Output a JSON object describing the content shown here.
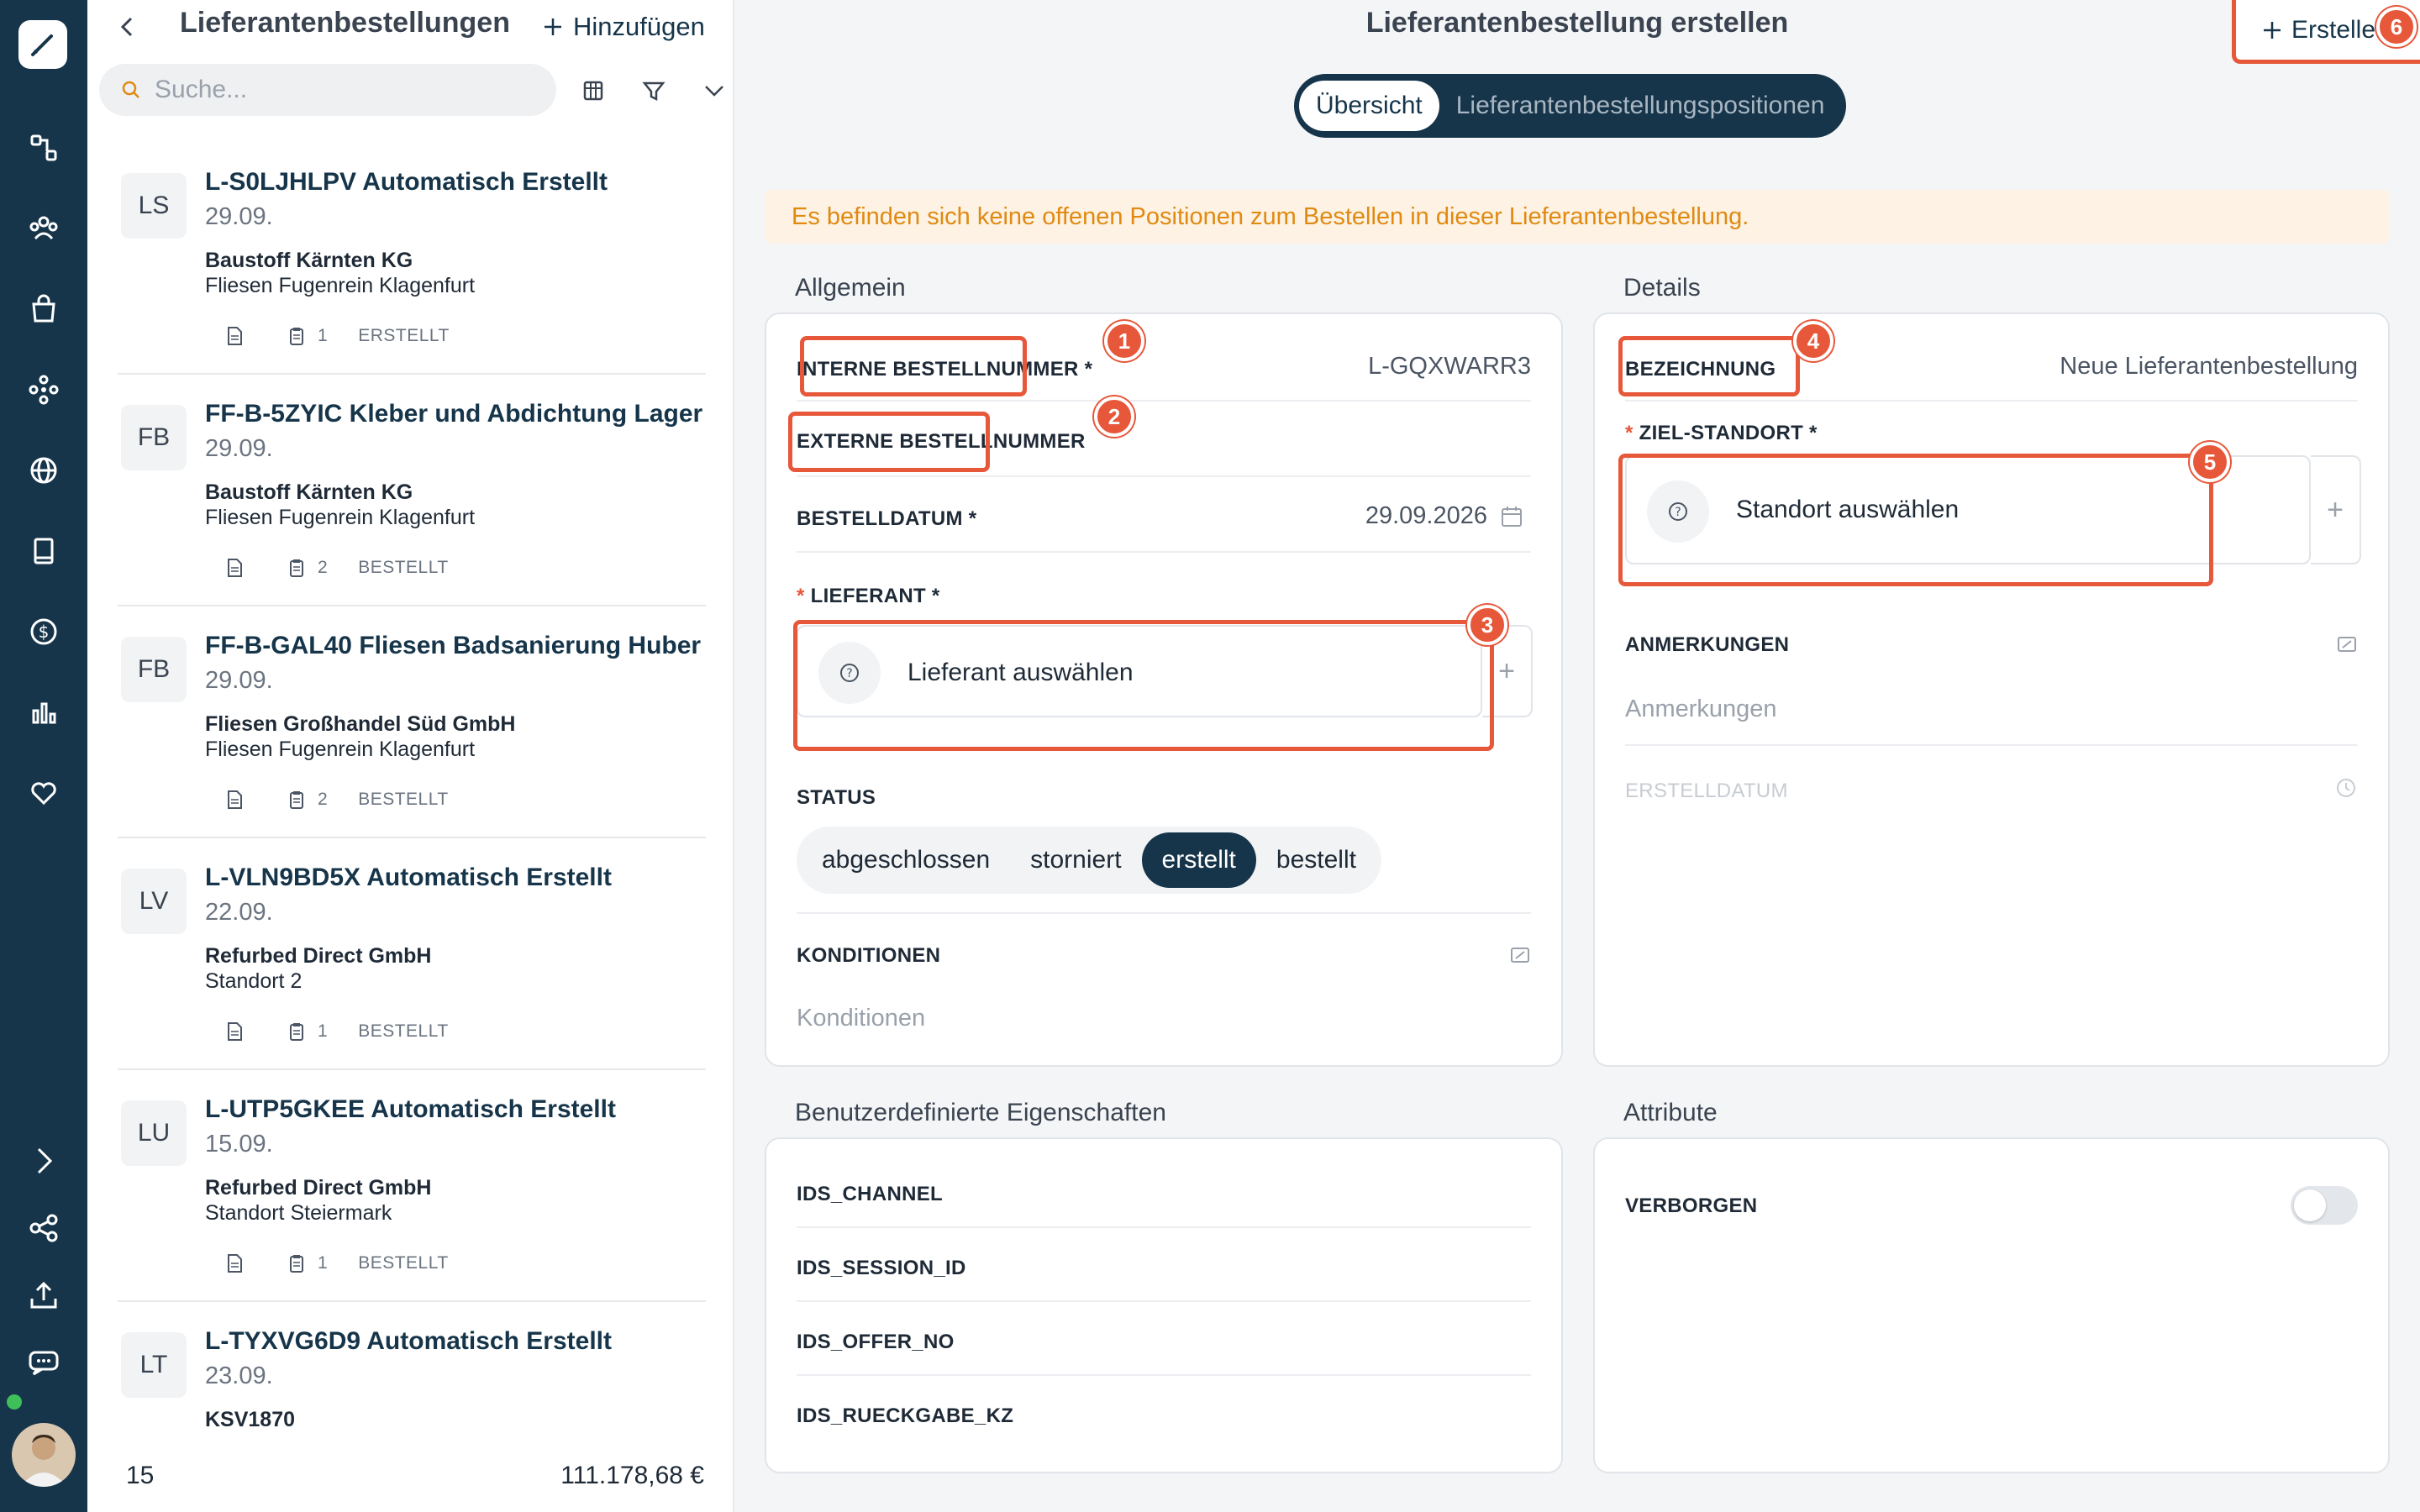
{
  "list": {
    "title": "Lieferantenbestellungen",
    "add_label": "Hinzufügen",
    "search_placeholder": "Suche...",
    "items": [
      {
        "badge": "LS",
        "title": "L-S0LJHLPV Automatisch Erstellt",
        "date": "29.09.",
        "supplier": "Baustoff Kärnten KG",
        "location": "Fliesen Fugenrein Klagenfurt",
        "count": "1",
        "status": "ERSTELLT"
      },
      {
        "badge": "FB",
        "title": "FF-B-5ZYIC Kleber und Abdichtung Lager",
        "date": "29.09.",
        "supplier": "Baustoff Kärnten KG",
        "location": "Fliesen Fugenrein Klagenfurt",
        "count": "2",
        "status": "BESTELLT"
      },
      {
        "badge": "FB",
        "title": "FF-B-GAL40 Fliesen Badsanierung Huber",
        "date": "29.09.",
        "supplier": "Fliesen Großhandel Süd GmbH",
        "location": "Fliesen Fugenrein Klagenfurt",
        "count": "2",
        "status": "BESTELLT"
      },
      {
        "badge": "LV",
        "title": "L-VLN9BD5X Automatisch Erstellt",
        "date": "22.09.",
        "supplier": "Refurbed Direct GmbH",
        "location": "Standort 2",
        "count": "1",
        "status": "BESTELLT"
      },
      {
        "badge": "LU",
        "title": "L-UTP5GKEE Automatisch Erstellt",
        "date": "15.09.",
        "supplier": "Refurbed Direct GmbH",
        "location": "Standort Steiermark",
        "count": "1",
        "status": "BESTELLT"
      },
      {
        "badge": "LT",
        "title": "L-TYXVG6D9 Automatisch Erstellt",
        "date": "23.09.",
        "supplier": "KSV1870",
        "location": "",
        "count": "",
        "status": ""
      }
    ],
    "footer_count": "15",
    "footer_sum": "111.178,68 €"
  },
  "main": {
    "title": "Lieferantenbestellung erstellen",
    "create_label": "Erstellen",
    "tabs": [
      "Übersicht",
      "Lieferantenbestellungspositionen"
    ],
    "warning": "Es befinden sich keine offenen Positionen zum Bestellen in dieser Lieferantenbestellung.",
    "general": {
      "heading": "Allgemein",
      "internal_label": "INTERNE BESTELLNUMMER *",
      "internal_value": "L-GQXWARR3",
      "external_label": "EXTERNE BESTELLNUMMER",
      "date_label": "BESTELLDATUM *",
      "date_value": "29.09.2026",
      "supplier_label": "LIEFERANT *",
      "supplier_picker": "Lieferant auswählen",
      "status_label": "STATUS",
      "status_options": [
        "abgeschlossen",
        "storniert",
        "erstellt",
        "bestellt"
      ],
      "status_selected": "erstellt",
      "conditions_label": "KONDITIONEN",
      "conditions_placeholder": "Konditionen"
    },
    "details": {
      "heading": "Details",
      "name_label": "BEZEICHNUNG",
      "name_value": "Neue Lieferantenbestellung",
      "location_label": "ZIEL-STANDORT *",
      "location_picker": "Standort auswählen",
      "notes_label": "ANMERKUNGEN",
      "notes_placeholder": "Anmerkungen",
      "created_label": "ERSTELLDATUM"
    },
    "custom": {
      "heading": "Benutzerdefinierte Eigenschaften",
      "fields": [
        "IDS_CHANNEL",
        "IDS_SESSION_ID",
        "IDS_OFFER_NO",
        "IDS_RUECKGABE_KZ"
      ]
    },
    "attributes": {
      "heading": "Attribute",
      "hidden_label": "VERBORGEN",
      "hidden_on": false
    },
    "markers": [
      "1",
      "2",
      "3",
      "4",
      "5",
      "6"
    ]
  },
  "colors": {
    "primary": "#16354a",
    "accent": "#e7573a",
    "warning_bg": "#fdf2e3",
    "warning_text": "#e08a12"
  }
}
